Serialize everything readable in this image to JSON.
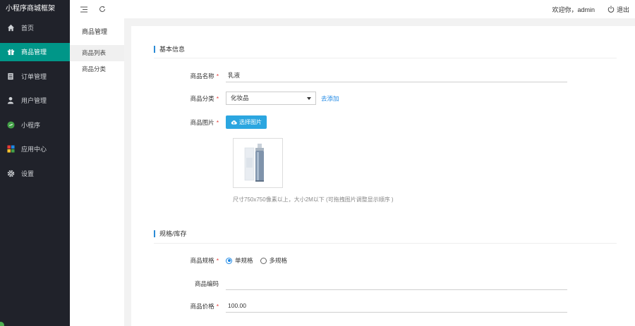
{
  "app": {
    "brand": "小程序商城框架",
    "sidebar": [
      {
        "label": "首页",
        "icon": "home-icon"
      },
      {
        "label": "商品管理",
        "icon": "gift-icon",
        "active": true
      },
      {
        "label": "订单管理",
        "icon": "document-icon"
      },
      {
        "label": "用户管理",
        "icon": "user-icon"
      },
      {
        "label": "小程序",
        "icon": "mini-program-icon"
      },
      {
        "label": "应用中心",
        "icon": "apps-icon"
      },
      {
        "label": "设置",
        "icon": "gear-icon"
      }
    ]
  },
  "topbar": {
    "welcome": "欢迎你，admin",
    "logout": "退出"
  },
  "subnav": {
    "title": "商品管理",
    "items": [
      {
        "label": "商品列表",
        "active": true
      },
      {
        "label": "商品分类"
      }
    ]
  },
  "form": {
    "basic_title": "基本信息",
    "name_label": "商品名称",
    "name_value": "乳液",
    "category_label": "商品分类",
    "category_value": "化妆品",
    "category_add": "去添加",
    "image_label": "商品图片",
    "image_button": "选择图片",
    "image_hint": "尺寸750x750像素以上，大小2M以下 (可拖拽图片调整显示顺序 )",
    "spec_title": "规格/库存",
    "spec_label": "商品规格",
    "spec_single": "单规格",
    "spec_multi": "多规格",
    "code_label": "商品编码",
    "code_value": "",
    "price_label": "商品价格",
    "price_value": "100.00",
    "required_mark": "*"
  },
  "colors": {
    "sidebar_bg": "#20222a",
    "active_bg": "#009688",
    "accent_blue": "#1e88e5",
    "upload_btn": "#2ba6e0"
  }
}
